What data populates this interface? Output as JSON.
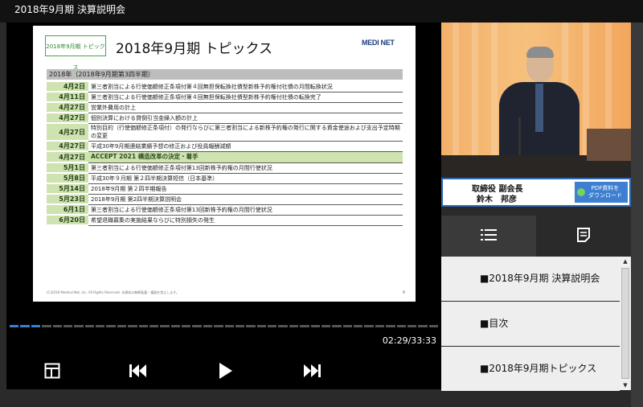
{
  "window": {
    "title": "2018年9月期 決算説明会"
  },
  "slide": {
    "badge": "2018年9月期 トピックス",
    "title": "2018年9月期 トピックス",
    "logo": "MEDI NET",
    "period": "2018年（2018年9月期第3四半期）",
    "rows": [
      {
        "date": "4月2日",
        "text": "第三者割当による行使価額修正条項付第４回無担保転換社債型新株予約権付社債の月間転換状況"
      },
      {
        "date": "4月11日",
        "text": "第三者割当による行使価額修正条項付第４回無担保転換社債型新株予約権付社債の転換完了"
      },
      {
        "date": "4月27日",
        "text": "営業外費用の計上"
      },
      {
        "date": "4月27日",
        "text": "個別決算における貸倒引当金繰入額の計上"
      },
      {
        "date": "4月27日",
        "text": "特別目的（行使価額修正条項付）の発行ならびに第三者割当による新株予約権の発行に関する資金使途および支出予定時期の変更"
      },
      {
        "date": "4月27日",
        "text": "平成30年9月期連結業績予想の修正および役員報酬減額"
      },
      {
        "date": "4月27日",
        "text": "ACCEPT 2021 構造改革の決定・着手"
      },
      {
        "date": "5月1日",
        "text": "第三者割当による行使価額修正条項付第13回新株予約権の月間行使状況"
      },
      {
        "date": "5月8日",
        "text": "平成30年９月期 第２四半期決算短信（日本基準）"
      },
      {
        "date": "5月14日",
        "text": "2018年9月期 第２四半期報告"
      },
      {
        "date": "5月23日",
        "text": "2018年9月期 第2四半期決算説明会"
      },
      {
        "date": "6月1日",
        "text": "第三者割当による行使価額修正条項付第13回新株予約権の月間行使状況"
      },
      {
        "date": "6月20日",
        "text": "希望退職募集の実施結果ならびに特別損失の発生"
      }
    ],
    "footer": "(C)2018 Medical Net, Inc. All Rights Reserved. 本資料の無断転載・複製を禁止します。",
    "page": "6"
  },
  "player": {
    "time": "02:29/33:33",
    "progress": 0.07,
    "icons": {
      "layout": "layout-icon",
      "prev": "skip-back-icon",
      "play": "play-icon",
      "next": "skip-forward-icon"
    }
  },
  "speaker": {
    "role": "取締役 副会長",
    "name": "鈴木　邦彦",
    "pdf_button": "PDF資料を\nダウンロード"
  },
  "tabs": {
    "list": "list-icon",
    "doc": "document-icon"
  },
  "chapters": [
    "■2018年9月期 決算説明会",
    "■目次",
    "■2018年9月期トピックス"
  ]
}
